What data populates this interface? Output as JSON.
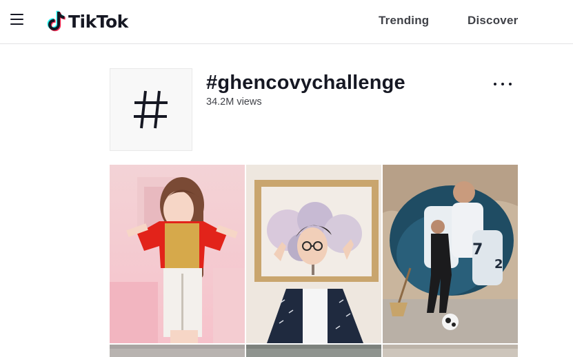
{
  "header": {
    "logo_text": "TikTok",
    "nav": {
      "trending": "Trending",
      "discover": "Discover"
    }
  },
  "challenge": {
    "title": "#ghencovychallenge",
    "views": "34.2M views",
    "cover_icon": "hashtag-icon"
  },
  "colors": {
    "brand_cyan": "#25f4ee",
    "brand_red": "#fe2c55",
    "text_primary": "#161823"
  }
}
